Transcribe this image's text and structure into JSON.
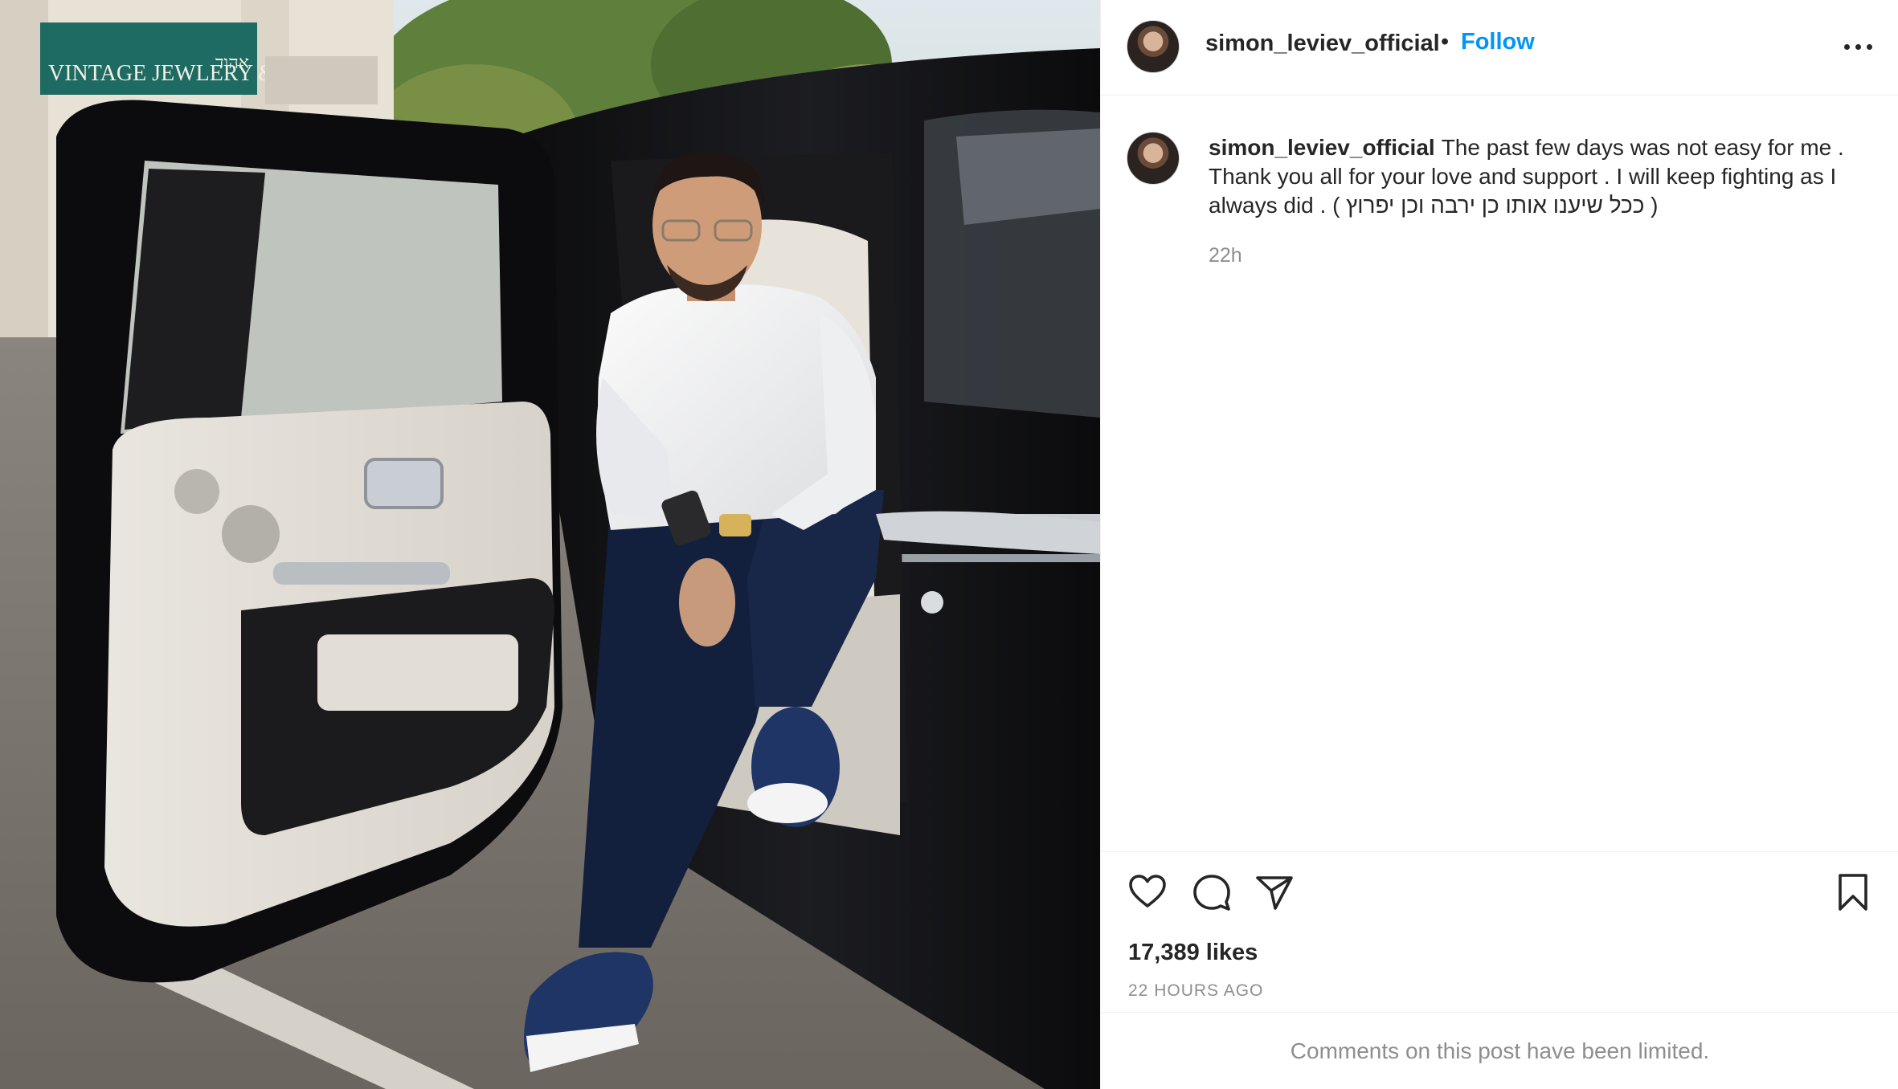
{
  "post": {
    "image_alt": "Man in white shirt sitting in the open rear door of a black luxury car",
    "storefront_sign": "VINTAGE JEWLERY & GIFTS",
    "storefront_sign_hebrew": "אהוד"
  },
  "header": {
    "username": "simon_leviev_official",
    "separator": "•",
    "follow_label": "Follow"
  },
  "caption": {
    "username": "simon_leviev_official",
    "text": "The past few days was not easy for me . Thank you all for your love and support . I will keep fighting as I always did . ( ככל שיענו אותו כן ירבה וכן יפרוץ )",
    "time": "22h"
  },
  "actions": {
    "icons": [
      "heart-icon",
      "comment-icon",
      "share-icon",
      "bookmark-icon"
    ]
  },
  "stats": {
    "likes": "17,389 likes",
    "posted_ago": "22 HOURS AGO"
  },
  "comments": {
    "notice": "Comments on this post have been limited."
  },
  "colors": {
    "accent": "#0095f6",
    "text": "#262626",
    "muted": "#8e8e8e",
    "border": "#efefef"
  }
}
